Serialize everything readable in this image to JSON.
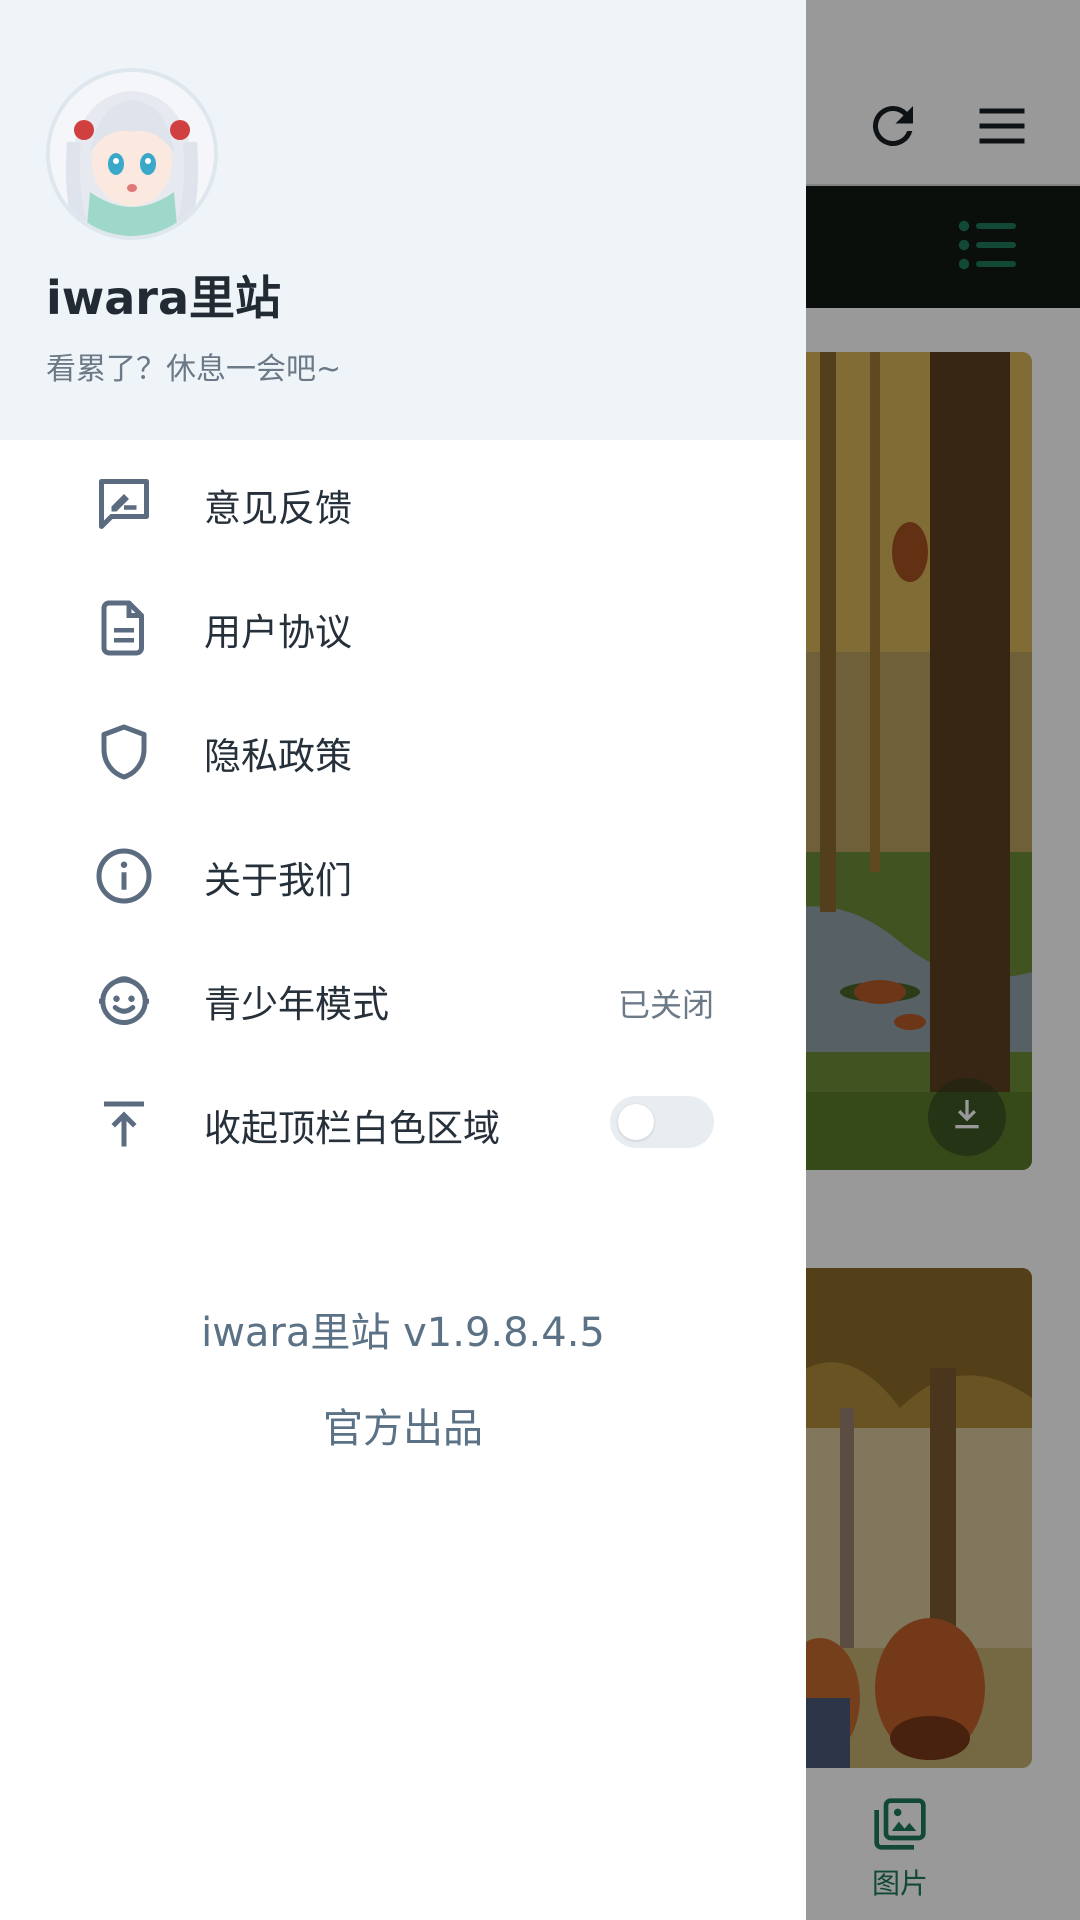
{
  "drawer": {
    "app_name": "iwara里站",
    "subtitle": "看累了？休息一会吧~",
    "avatar_icon": "anime-girl-avatar",
    "menu": [
      {
        "label": "意见反馈",
        "icon": "feedback-icon"
      },
      {
        "label": "用户协议",
        "icon": "document-icon"
      },
      {
        "label": "隐私政策",
        "icon": "shield-icon"
      },
      {
        "label": "关于我们",
        "icon": "info-icon"
      },
      {
        "label": "青少年模式",
        "icon": "child-face-icon",
        "status": "已关闭"
      },
      {
        "label": "收起顶栏白色区域",
        "icon": "collapse-top-icon",
        "toggle_on": false
      }
    ],
    "version": "iwara里站 v1.9.8.4.5",
    "credit": "官方出品"
  },
  "background": {
    "bottom_nav_label": "图片",
    "accent_color": "#1f7a5a",
    "dark_bar_color": "#121a14"
  },
  "colors": {
    "header_bg": "#eff4f9",
    "icon_color": "#5b6b80",
    "text_color": "#26303a"
  }
}
